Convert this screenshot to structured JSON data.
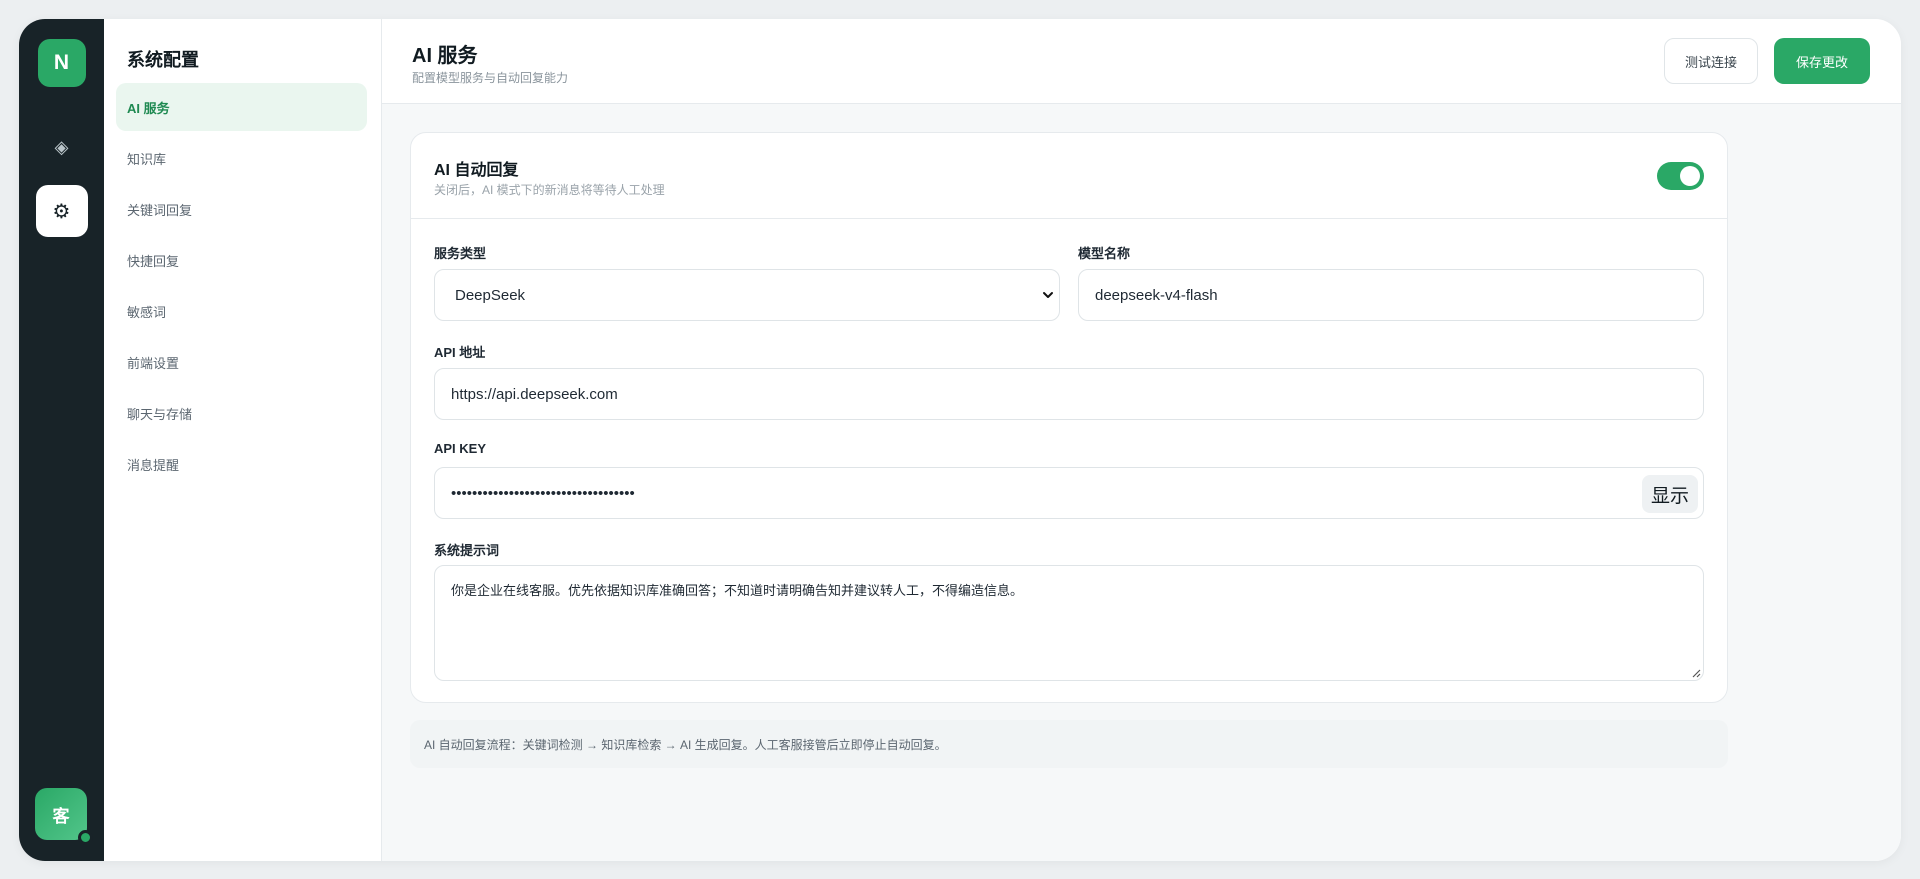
{
  "rail": {
    "brand_letter": "N",
    "diamond_icon": "◈",
    "settings_icon": "⚙",
    "user_avatar": "客"
  },
  "sidebar": {
    "title": "系统配置",
    "items": [
      {
        "label": "AI 服务",
        "active": true
      },
      {
        "label": "知识库"
      },
      {
        "label": "关键词回复"
      },
      {
        "label": "快捷回复"
      },
      {
        "label": "敏感词"
      },
      {
        "label": "前端设置"
      },
      {
        "label": "聊天与存储"
      },
      {
        "label": "消息提醒"
      }
    ]
  },
  "header": {
    "title": "AI 服务",
    "subtitle": "配置模型服务与自动回复能力",
    "test_button": "测试连接",
    "save_button": "保存更改"
  },
  "card": {
    "title": "AI 自动回复",
    "description": "关闭后，AI 模式下的新消息将等待人工处理",
    "auto_reply_enabled": true,
    "service_type_label": "服务类型",
    "service_type_value": "DeepSeek",
    "model_name_label": "模型名称",
    "model_name_value": "deepseek-v4-flash",
    "api_url_label": "API 地址",
    "api_url_value": "https://api.deepseek.com",
    "api_key_label": "API KEY",
    "api_key_value": "•••••••••••••••••••••••••••••••••••",
    "show_button": "显示",
    "prompt_label": "系统提示词",
    "prompt_value": "你是企业在线客服。优先依据知识库准确回答；不知道时请明确告知并建议转人工，不得编造信息。"
  },
  "footer_note": "AI 自动回复流程：关键词检测 → 知识库检索 → AI 生成回复。人工客服接管后立即停止自动回复。",
  "colors": {
    "accent": "#2aa866",
    "rail_bg": "#182328"
  }
}
